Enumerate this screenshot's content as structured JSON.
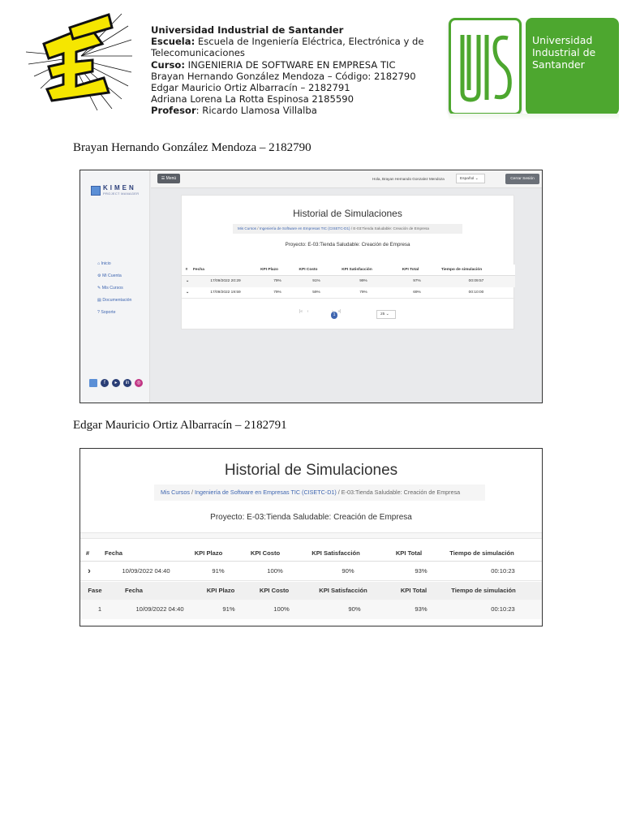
{
  "header": {
    "university": "Universidad Industrial de Santander",
    "escuela_label": "Escuela:",
    "escuela_value": " Escuela de Ingeniería Eléctrica, Electrónica y de Telecomunicaciones",
    "curso_label": "Curso:",
    "curso_value": " INGENIERIA DE SOFTWARE EN EMPRESA TIC",
    "student1": "Brayan Hernando González Mendoza – Código: 2182790",
    "student2": "Edgar Mauricio Ortiz Albarracín – 2182791",
    "student3": "Adriana Lorena La Rotta Espinosa 2185590",
    "profesor_label": "Profesor",
    "profesor_value": ": Ricardo Llamosa Villalba",
    "uis_logo_text": "Universidad Industrial de Santander",
    "uis_line1": "Universidad",
    "uis_line2": "Industrial de",
    "uis_line3": "Santander",
    "colors": {
      "uis_green": "#4da72f",
      "et_yellow": "#f5e600"
    }
  },
  "caption1": "Brayan Hernando González Mendoza – 2182790",
  "caption2": "Edgar Mauricio Ortiz Albarracín – 2182791",
  "shot1": {
    "brand": "KIMEN",
    "brand_sub": "PROJECT MANAGER",
    "menu_label": "Menú",
    "greeting": "Hola, Brayan Hernando Gonzalez Mendoza",
    "language": "Español",
    "logout_label": "Cerrar Sesión",
    "nav": [
      "Inicio",
      "Mi Cuenta",
      "Mis Cursos",
      "Documentación",
      "Soporte"
    ],
    "title": "Historial de Simulaciones",
    "breadcrumb": {
      "item1": "Mis Cursos",
      "sep": "/",
      "item2": "Ingeniería de Software en Empresas TIC (CISETC-D1)",
      "item3": "E-03:Tienda Saludable: Creación de Empresa"
    },
    "project": "Proyecto: E-03:Tienda Saludable: Creación de Empresa",
    "columns": [
      "#",
      "Fecha",
      "KPI Plazo",
      "KPI Costo",
      "KPI Satisfacción",
      "KPI Total",
      "Tiempo de simulación"
    ],
    "rows": [
      {
        "toggle": "⌄",
        "fecha": "17/09/2022 20:29",
        "plazo": "79%",
        "costo": "91%",
        "satisfaccion": "99%",
        "total": "97%",
        "tiempo": "00:09:57"
      },
      {
        "toggle": "⌄",
        "fecha": "17/09/2022 19:59",
        "plazo": "79%",
        "costo": "59%",
        "satisfaccion": "79%",
        "total": "69%",
        "tiempo": "00:10:00"
      }
    ],
    "pager": {
      "first": "|«",
      "prev": "‹",
      "page": "1",
      "next": "›",
      "last": "»|",
      "page_size": "25"
    }
  },
  "shot2": {
    "title": "Historial de Simulaciones",
    "breadcrumb": {
      "item1": "Mis Cursos",
      "sep": "/",
      "item2": "Ingeniería de Software en Empresas TIC (CISETC-D1)",
      "item3": "E-03:Tienda Saludable: Creación de Empresa"
    },
    "project": "Proyecto: E-03:Tienda Saludable: Creación de Empresa",
    "columns": [
      "#",
      "Fecha",
      "KPI Plazo",
      "KPI Costo",
      "KPI Satisfacción",
      "KPI Total",
      "Tiempo de simulación"
    ],
    "row": {
      "toggle": "›",
      "fecha": "10/09/2022 04:40",
      "plazo": "91%",
      "costo": "100%",
      "satisfaccion": "90%",
      "total": "93%",
      "tiempo": "00:10:23"
    },
    "sub_columns": [
      "Fase",
      "Fecha",
      "KPI Plazo",
      "KPI Costo",
      "KPI Satisfacción",
      "KPI Total",
      "Tiempo de simulación"
    ],
    "sub_row": {
      "fase": "1",
      "fecha": "10/09/2022 04:40",
      "plazo": "91%",
      "costo": "100%",
      "satisfaccion": "90%",
      "total": "93%",
      "tiempo": "00:10:23"
    }
  }
}
